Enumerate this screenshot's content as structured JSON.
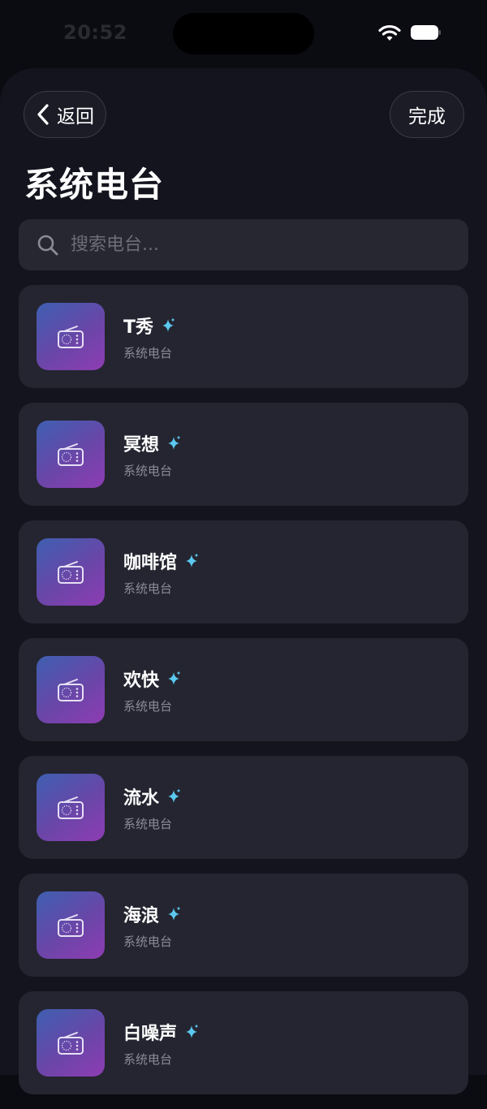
{
  "status_bar": {
    "time": "20:52",
    "icons": [
      "wifi-icon",
      "battery-icon"
    ]
  },
  "header": {
    "back_label": "返回",
    "done_label": "完成",
    "title": "系统电台"
  },
  "search": {
    "placeholder": "搜索电台...",
    "value": ""
  },
  "stations": [
    {
      "name": "T秀",
      "subtitle": "系统电台",
      "icon": "radio-icon",
      "badge_icon": "sparkle-icon"
    },
    {
      "name": "冥想",
      "subtitle": "系统电台",
      "icon": "radio-icon",
      "badge_icon": "sparkle-icon"
    },
    {
      "name": "咖啡馆",
      "subtitle": "系统电台",
      "icon": "radio-icon",
      "badge_icon": "sparkle-icon"
    },
    {
      "name": "欢快",
      "subtitle": "系统电台",
      "icon": "radio-icon",
      "badge_icon": "sparkle-icon"
    },
    {
      "name": "流水",
      "subtitle": "系统电台",
      "icon": "radio-icon",
      "badge_icon": "sparkle-icon"
    },
    {
      "name": "海浪",
      "subtitle": "系统电台",
      "icon": "radio-icon",
      "badge_icon": "sparkle-icon"
    },
    {
      "name": "白噪声",
      "subtitle": "系统电台",
      "icon": "radio-icon",
      "badge_icon": "sparkle-icon"
    }
  ],
  "colors": {
    "background": "#0b0b12",
    "sheet": "#13141d",
    "card": "#242530",
    "accent_sparkle": "#5cc8f0",
    "art_gradient_start": "#3e5fb0",
    "art_gradient_end": "#8e3cb2"
  }
}
